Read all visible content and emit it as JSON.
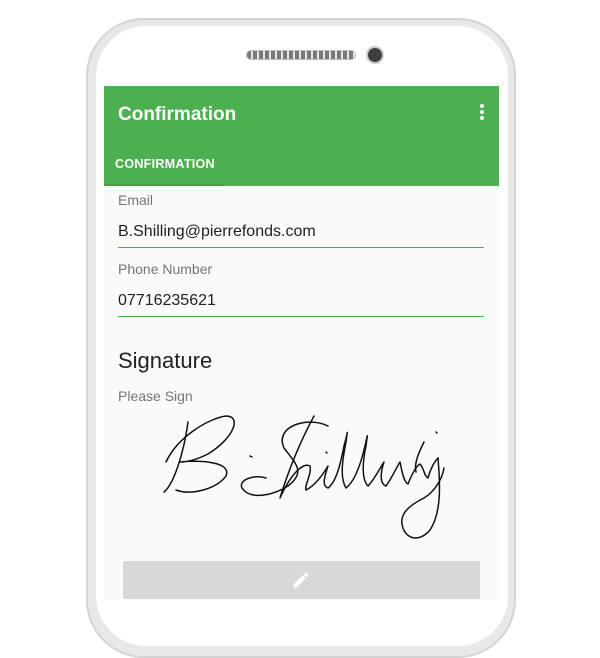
{
  "appbar": {
    "title": "Confirmation"
  },
  "tabs": [
    {
      "label": "CONFIRMATION"
    }
  ],
  "form": {
    "email_label": "Email",
    "email_value": "B.Shilling@pierrefonds.com",
    "phone_label": "Phone Number",
    "phone_value": "07716235621"
  },
  "signature": {
    "heading": "Signature",
    "hint": "Please Sign"
  },
  "icons": {
    "overflow": "more-vert-icon",
    "edit": "pencil-icon"
  },
  "colors": {
    "accent": "#4caf50",
    "button_disabled": "#d8d8d8"
  }
}
